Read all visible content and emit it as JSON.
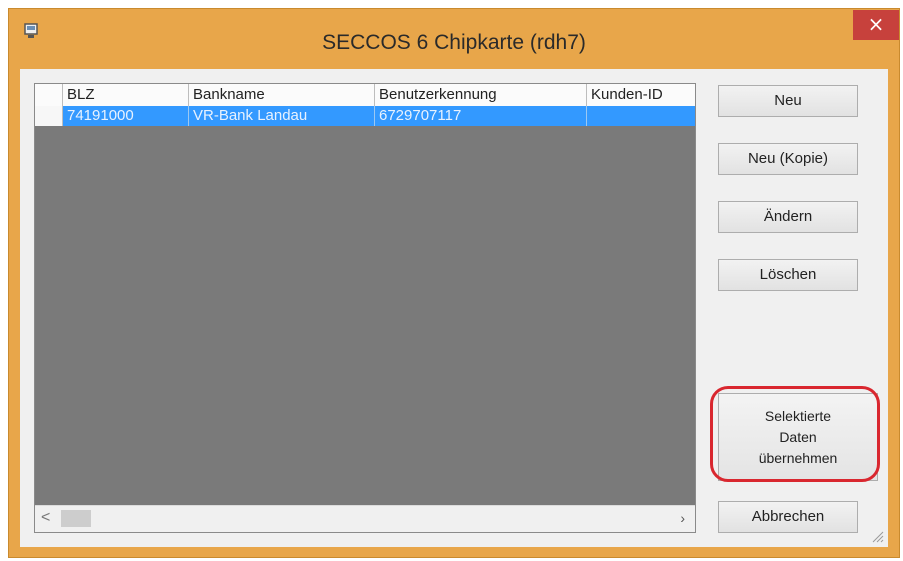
{
  "window": {
    "title": "SECCOS 6 Chipkarte (rdh7)",
    "close_glyph": "×"
  },
  "list": {
    "columns": [
      "BLZ",
      "Bankname",
      "Benutzerkennung",
      "Kunden-ID"
    ],
    "rows": [
      [
        "74191000",
        "VR-Bank Landau",
        "6729707117",
        ""
      ]
    ],
    "scroll_left_glyph": "<",
    "scroll_right_glyph": "›"
  },
  "buttons": {
    "new": "Neu",
    "new_copy": "Neu (Kopie)",
    "change": "Ändern",
    "delete": "Löschen",
    "apply_selected": [
      "Selektierte",
      "Daten",
      "übernehmen"
    ],
    "cancel": "Abbrechen"
  },
  "colors": {
    "frame": "#e8a64a",
    "selection": "#3399ff",
    "close": "#c7413c",
    "highlight": "#d9272f"
  },
  "icons": {
    "app": "window-app-icon",
    "close": "close-icon",
    "resize": "resize-grip-icon"
  }
}
